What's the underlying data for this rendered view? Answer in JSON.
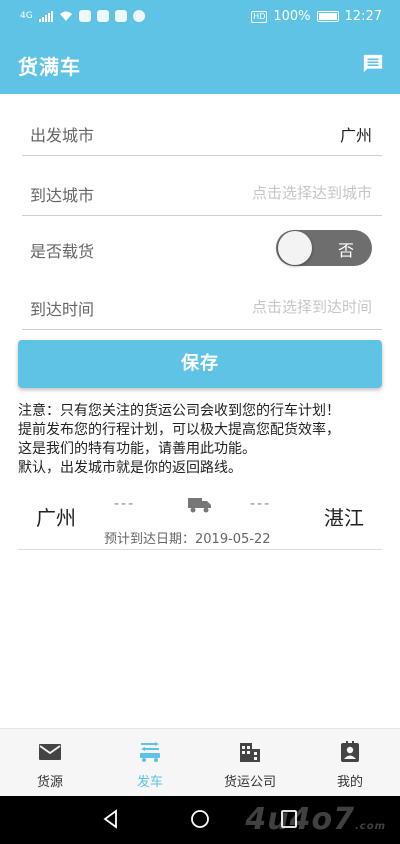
{
  "status_bar": {
    "battery": "100%",
    "time": "12:27",
    "hd": "HD",
    "network": "4G"
  },
  "app": {
    "title": "货满车"
  },
  "form": {
    "depart_label": "出发城市",
    "depart_value": "广州",
    "arrive_label": "到达城市",
    "arrive_placeholder": "点击选择达到城市",
    "loaded_label": "是否载货",
    "loaded_value": "否",
    "time_label": "到达时间",
    "time_placeholder": "点击选择到达时间"
  },
  "save_label": "保存",
  "notice": {
    "line1": "注意：只有您关注的货运公司会收到您的行车计划！",
    "line2": "提前发布您的行程计划，可以极大提高您配货效率，",
    "line3": "这是我们的特有功能，请善用此功能。",
    "line4": "默认，出发城市就是你的返回路线。"
  },
  "route": {
    "from": "广州",
    "to": "湛江",
    "dash": "---",
    "eta": "预计到达日期：2019-05-22"
  },
  "nav": [
    {
      "label": "货源",
      "icon": "mail-icon"
    },
    {
      "label": "发车",
      "icon": "truck-dispatch-icon"
    },
    {
      "label": "货运公司",
      "icon": "building-icon"
    },
    {
      "label": "我的",
      "icon": "profile-icon"
    }
  ],
  "watermark": {
    "text": "4u4o7",
    "suffix": ".com"
  },
  "colors": {
    "accent": "#5ec3e5",
    "toggle_off": "#6e6e6e"
  }
}
